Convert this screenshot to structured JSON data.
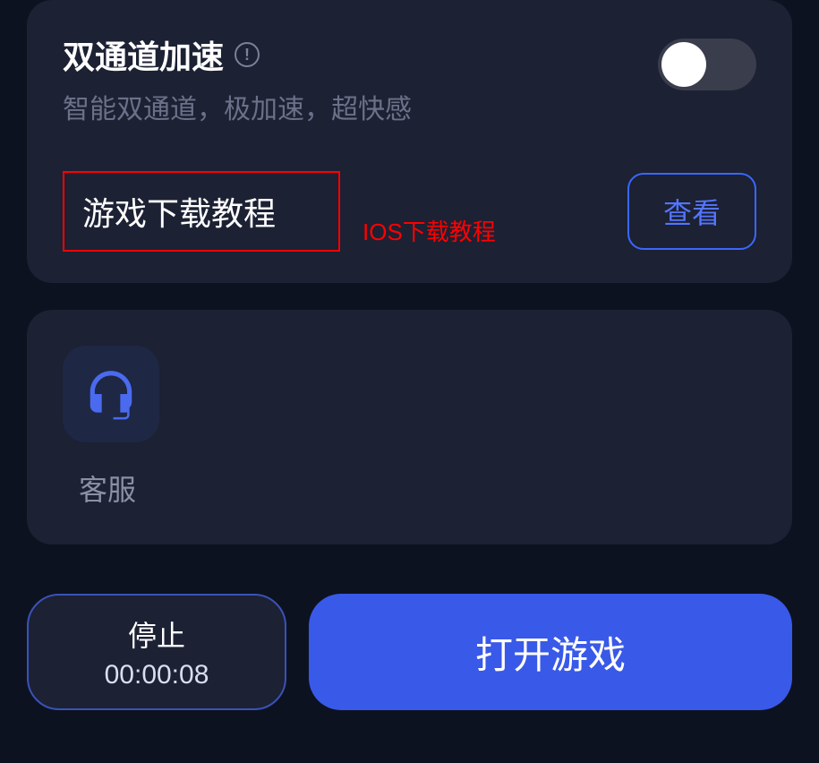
{
  "dual_channel": {
    "title": "双通道加速",
    "subtitle": "智能双通道，极加速，超快感",
    "info_glyph": "!",
    "enabled": false
  },
  "tutorial": {
    "title": "游戏下载教程",
    "annotation": "IOS下载教程",
    "view_button": "查看"
  },
  "service": {
    "label": "客服"
  },
  "bottom": {
    "stop_label": "停止",
    "timer": "00:00:08",
    "open_game": "打开游戏"
  },
  "colors": {
    "accent": "#3959e8",
    "highlight": "#ff0000"
  }
}
